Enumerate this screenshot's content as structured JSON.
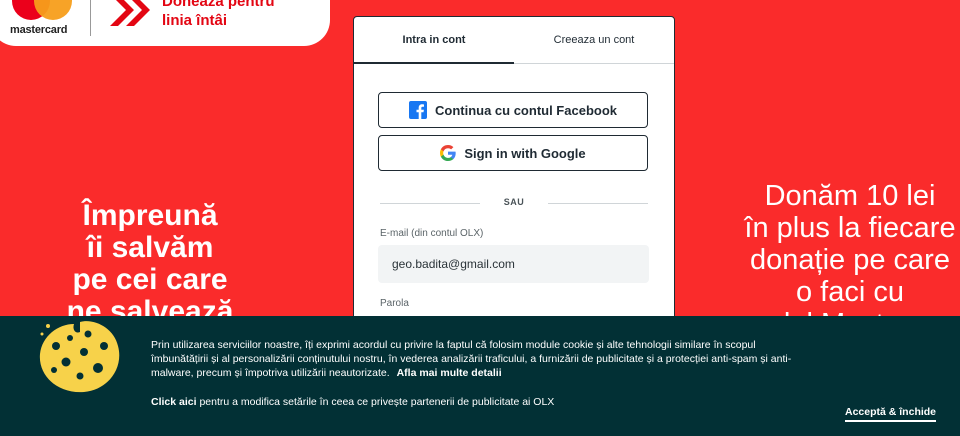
{
  "brand": {
    "mastercard_label": "mastercard",
    "campaign_line1": "Donează pentru",
    "campaign_line2": "linia întâi"
  },
  "left_slogan": [
    "Împreună",
    "îi salvăm",
    "pe cei care",
    "ne salvează"
  ],
  "right_slogan": [
    "Donăm 10 lei",
    "în plus la fiecare",
    "donație pe care",
    "o faci cu",
    "cardul Mastercard"
  ],
  "login": {
    "tabs": [
      {
        "label": "Intra in cont",
        "active": true
      },
      {
        "label": "Creeaza un cont",
        "active": false
      }
    ],
    "facebook_label": "Continua cu contul Facebook",
    "google_label": "Sign in with Google",
    "separator": "SAU",
    "email_label": "E-mail (din contul OLX)",
    "email_value": "geo.badita@gmail.com",
    "password_label": "Parola"
  },
  "cookie_banner": {
    "text": "Prin utilizarea serviciilor noastre, îți exprimi acordul cu privire la faptul că folosim module cookie și alte tehnologii similare în scopul îmbunătățirii și al personalizării conținutului nostru, în vederea analizării traficului, a furnizării de publicitate și a protecției anti-spam și anti-malware, precum și împotriva utilizării neautorizate.",
    "details_link": "Afla mai multe detalii",
    "click_here": "Click aici",
    "click_here_rest": " pentru a modifica setările în ceea ce privește partenerii de publicitate ai OLX",
    "accept_label": "Acceptă & închide"
  },
  "colors": {
    "background": "#fa2b2b",
    "panel_border": "#1f2a33",
    "banner": "#023035",
    "facebook": "#1877f2"
  }
}
